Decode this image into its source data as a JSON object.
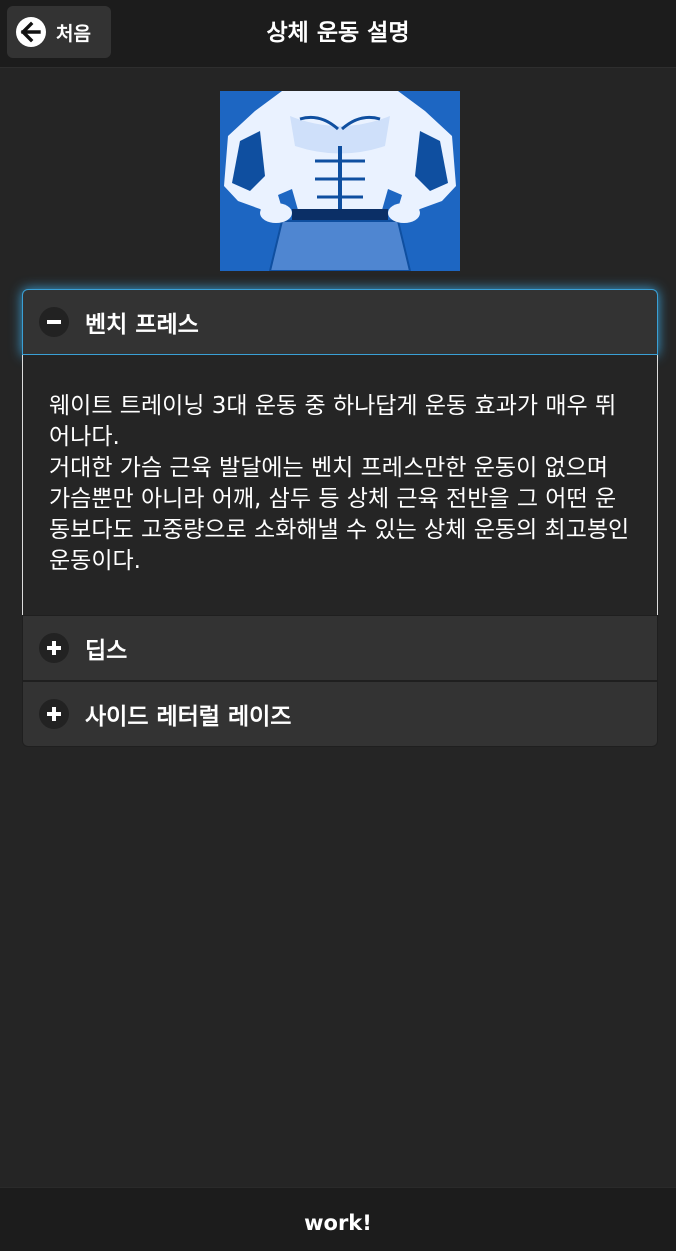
{
  "header": {
    "back_label": "처음",
    "title": "상체 운동 설명"
  },
  "accordion": {
    "items": [
      {
        "label": "벤치 프레스",
        "expanded": true,
        "body": "웨이트 트레이닝 3대 운동 중 하나답게 운동 효과가 매우 뛰어나다.\n거대한 가슴 근육 발달에는 벤치 프레스만한 운동이 없으며 가슴뿐만 아니라 어깨, 삼두 등 상체 근육 전반을 그 어떤 운동보다도 고중량으로 소화해낼 수 있는 상체 운동의 최고봉인 운동이다."
      },
      {
        "label": "딥스",
        "expanded": false
      },
      {
        "label": "사이드 레터럴 레이즈",
        "expanded": false
      }
    ]
  },
  "footer": {
    "label": "work!"
  },
  "colors": {
    "background": "#252525",
    "header": "#1c1c1c",
    "accent_glow": "#3aa0d6",
    "hero_blue": "#1a5fb4"
  },
  "icons": {
    "back": "arrow-left-icon",
    "collapse": "minus-icon",
    "expand": "plus-icon"
  }
}
